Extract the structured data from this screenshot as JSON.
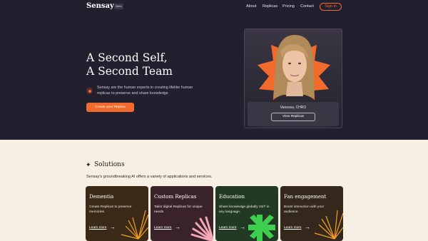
{
  "nav": {
    "logo": "Sensay",
    "logo_badge": "Beta",
    "links": [
      "About",
      "Replicas",
      "Pricing",
      "Contact"
    ],
    "signin": "Sign in"
  },
  "hero": {
    "headline_line1": "A Second Self,",
    "headline_line2": "A Second Team",
    "description": "Sensay are the human experts in creating lifelike human replicas to preserve and share knowledge",
    "cta": "Create your Replica",
    "person_name": "Vanessa, CHRO",
    "view_button": "View Replicas"
  },
  "solutions": {
    "title": "Solutions",
    "subtitle": "Sensay's groundbreaking AI offers a variety of applications and services.",
    "cards": [
      {
        "title": "Dementia",
        "description": "Create Replicas to preserve memories.",
        "link": "Learn more"
      },
      {
        "title": "Custom Replicas",
        "description": "Tailor digital Replicas for unique needs.",
        "link": "Learn more"
      },
      {
        "title": "Education",
        "description": "Share knowledge globally 24/7 in any language.",
        "link": "Learn more"
      },
      {
        "title": "Fan engagement",
        "description": "Boost interaction with your audience.",
        "link": "Learn more"
      }
    ]
  },
  "icons": {
    "sparkle": "✦",
    "arrow": "→"
  },
  "colors": {
    "hero_bg": "#221f2e",
    "page_bg": "#f7efe4",
    "accent": "#f36b2c",
    "card_dementia": "#3a2a17",
    "card_custom": "#3a2229",
    "card_education": "#223a23",
    "card_fan": "#33281b"
  }
}
